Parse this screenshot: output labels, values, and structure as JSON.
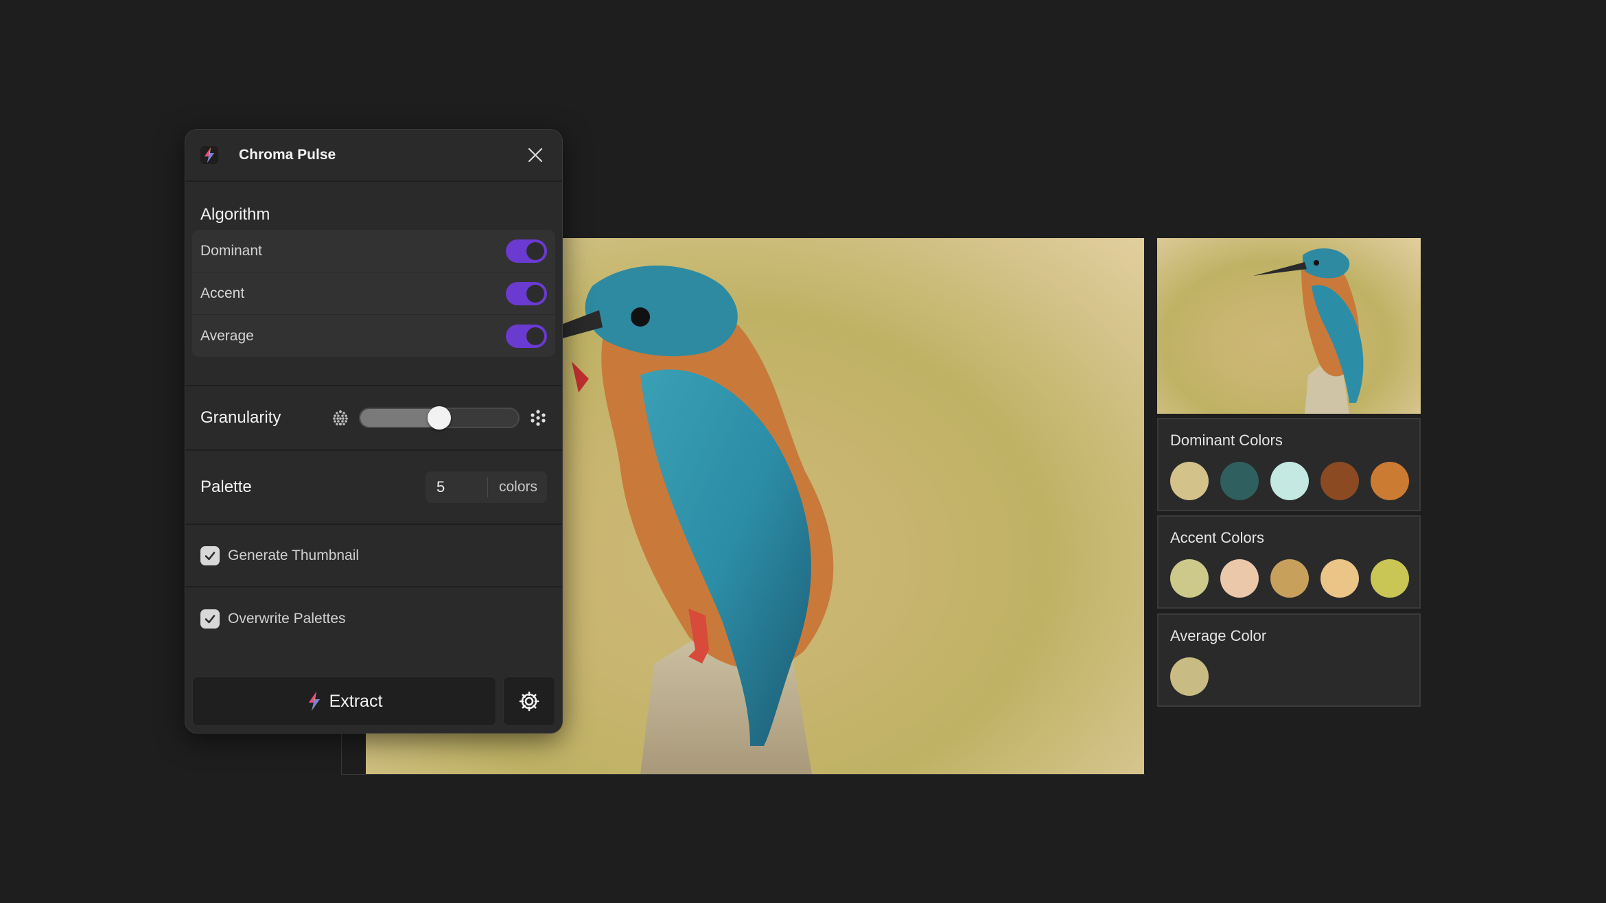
{
  "app": {
    "title": "Chroma Pulse",
    "icon": "bolt-app-icon"
  },
  "algorithm": {
    "title": "Algorithm",
    "toggles": [
      {
        "label": "Dominant",
        "on": true
      },
      {
        "label": "Accent",
        "on": true
      },
      {
        "label": "Average",
        "on": true
      }
    ]
  },
  "granularity": {
    "label": "Granularity",
    "value": 0.5
  },
  "palette": {
    "label": "Palette",
    "value": "5",
    "unit": "colors"
  },
  "options": {
    "generate_thumbnail": {
      "label": "Generate Thumbnail",
      "checked": true
    },
    "overwrite_palettes": {
      "label": "Overwrite Palettes",
      "checked": true
    }
  },
  "footer": {
    "extract_label": "Extract"
  },
  "results": {
    "dominant": {
      "title": "Dominant Colors",
      "colors": [
        "#d3c28a",
        "#2f5f5e",
        "#c4e8e2",
        "#8b4a22",
        "#cb7b32"
      ]
    },
    "accent": {
      "title": "Accent Colors",
      "colors": [
        "#cdc98a",
        "#ecc8aa",
        "#c7a15c",
        "#eac587",
        "#c9c655"
      ]
    },
    "average": {
      "title": "Average Color",
      "colors": [
        "#c8bc84"
      ]
    }
  },
  "colors": {
    "toggle_on": "#6a3ad1",
    "panel_bg": "#2a2a2a",
    "page_bg": "#1e1e1e"
  }
}
